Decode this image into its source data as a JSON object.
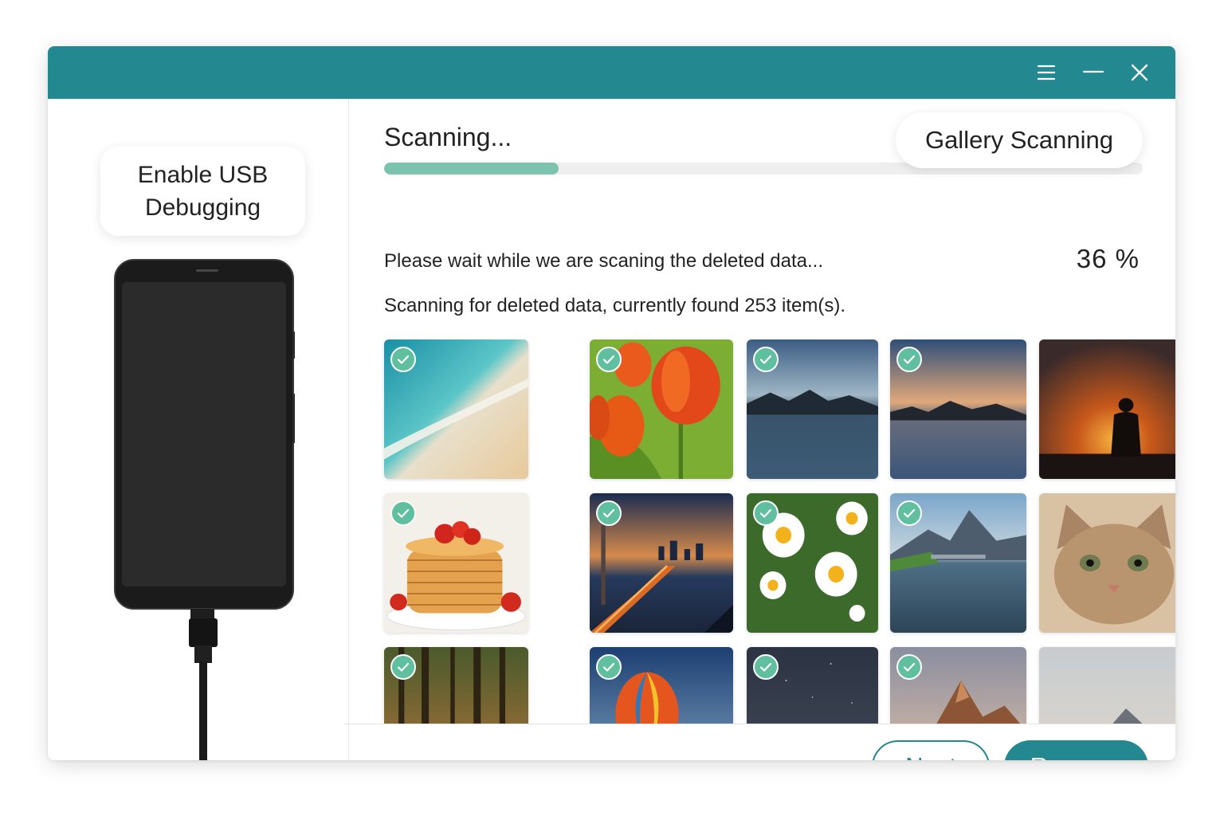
{
  "window": {
    "accent": "#23888f",
    "titlebar_controls": [
      "menu-icon",
      "minimize-icon",
      "close-icon"
    ]
  },
  "left_panel": {
    "usb_card_text": "Enable USB Debugging",
    "phone": "phone-icon"
  },
  "scan": {
    "title": "Scanning...",
    "badge": "Gallery Scanning",
    "progress": 0.23,
    "progress_color": "#7cc3ad",
    "wait_message": "Please wait while we are scaning the deleted data...",
    "percent": "36 %",
    "found_message": "Scanning for deleted data, currently found 253 item(s).",
    "check_color": "#5fbf9e"
  },
  "gallery": {
    "thumbnails": [
      {
        "subject": "beach",
        "checked": true
      },
      {
        "subject": "tulips",
        "checked": true
      },
      {
        "subject": "mountain-lake",
        "checked": true
      },
      {
        "subject": "mountain-lake-sunset",
        "checked": true
      },
      {
        "subject": "sunset-silhouette",
        "checked": false
      },
      {
        "subject": "pancakes",
        "checked": true
      },
      {
        "subject": "city-bridge-night",
        "checked": true
      },
      {
        "subject": "daisies",
        "checked": true
      },
      {
        "subject": "mountain-lake-bridge",
        "checked": true
      },
      {
        "subject": "cat",
        "checked": false
      },
      {
        "subject": "forest",
        "checked": true
      },
      {
        "subject": "hot-air-balloon",
        "checked": true
      },
      {
        "subject": "night-sky",
        "checked": true
      },
      {
        "subject": "mountain-peak",
        "checked": true
      },
      {
        "subject": "misty-mountain",
        "checked": false
      }
    ]
  },
  "footer": {
    "next_label": "Next",
    "recover_label": "Recover"
  }
}
